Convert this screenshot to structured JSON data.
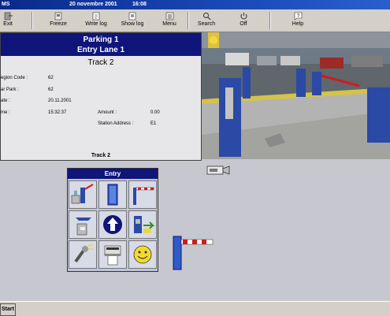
{
  "window": {
    "title_fragment": "MS",
    "date": "20 novembre 2001",
    "time": "16:08"
  },
  "toolbar": {
    "buttons": [
      {
        "label": "Exit",
        "icon": "exit-icon"
      },
      {
        "label": "Freeze",
        "icon": "freeze-icon"
      },
      {
        "label": "Write log",
        "icon": "write-log-icon"
      },
      {
        "label": "Show log",
        "icon": "show-log-icon"
      },
      {
        "label": "Menu",
        "icon": "menu-icon"
      },
      {
        "label": "Search",
        "icon": "search-icon"
      },
      {
        "label": "Off",
        "icon": "power-off-icon"
      },
      {
        "label": "Help",
        "icon": "help-icon"
      }
    ]
  },
  "track_panel": {
    "heading_line1": "Parking 1",
    "heading_line2": "Entry Lane 1",
    "track_title": "Track 2",
    "fields": {
      "region_label": "egion Code :",
      "region_value": "62",
      "carpark_label": "ar Park :",
      "carpark_value": "62",
      "date_label": "ate :",
      "date_value": "20.11.2001",
      "time_label": "me :",
      "time_value": "15:32:37",
      "amount_label": "Amount :",
      "amount_value": "0.00",
      "station_label": "Station Address :",
      "station_value": "E1"
    },
    "footer": "Track 2"
  },
  "entry_panel": {
    "heading": "Entry",
    "cells": [
      {
        "icon": "terminal-ticket-icon"
      },
      {
        "icon": "door-icon"
      },
      {
        "icon": "barrier-small-icon"
      },
      {
        "icon": "ticket-dispenser-icon"
      },
      {
        "icon": "up-arrow-icon"
      },
      {
        "icon": "card-reader-icon"
      },
      {
        "icon": "intercom-icon"
      },
      {
        "icon": "printer-icon"
      },
      {
        "icon": "smiley-icon"
      }
    ]
  },
  "colors": {
    "heading_blue": "#10157a",
    "barrier_red": "#d31a1a"
  },
  "taskbar": {
    "start_label": "Start"
  }
}
